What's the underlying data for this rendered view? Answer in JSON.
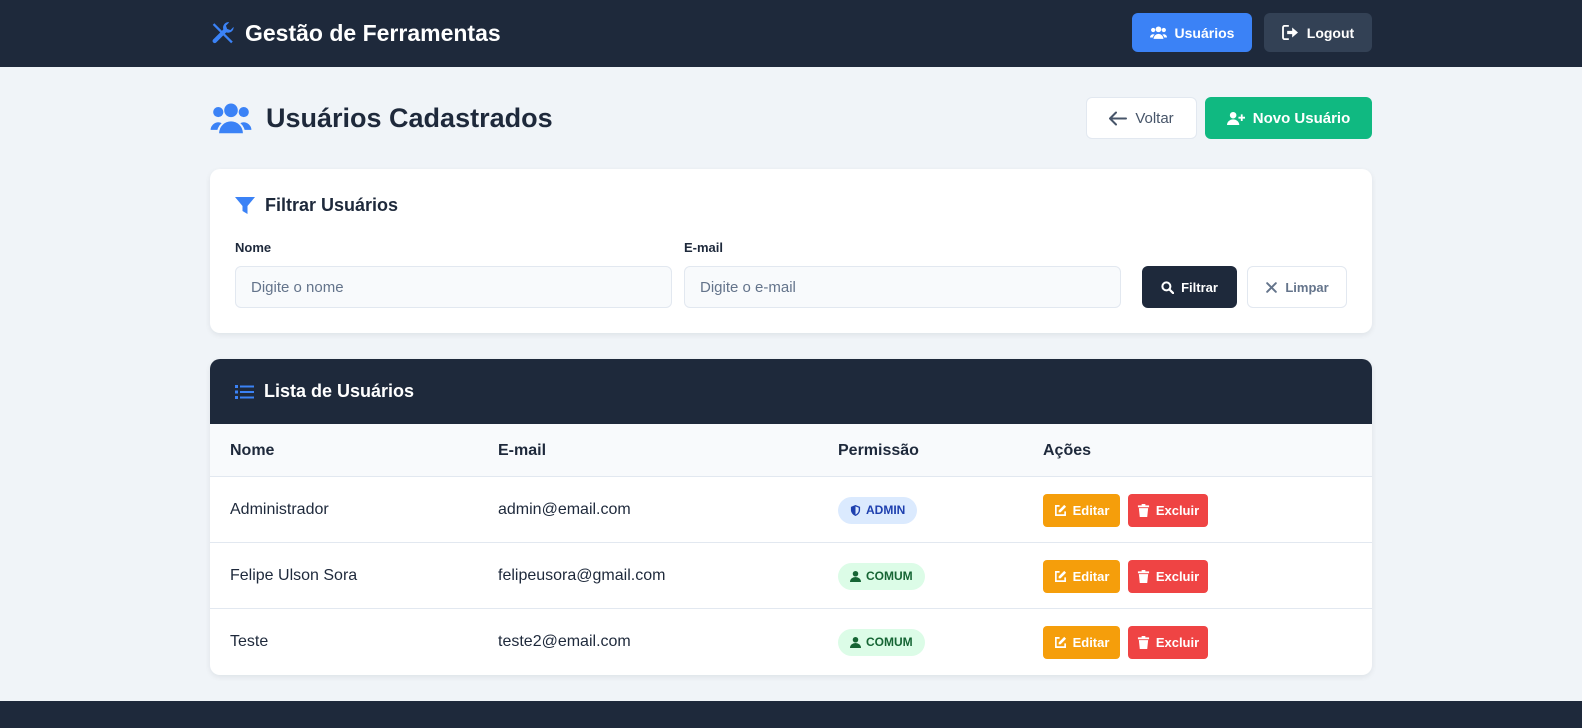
{
  "header": {
    "brand": "Gestão de Ferramentas",
    "brand_icon": "tools-icon",
    "users_label": "Usuários",
    "logout_label": "Logout"
  },
  "page": {
    "title": "Usuários Cadastrados",
    "title_icon": "users-icon",
    "back_label": "Voltar",
    "new_label": "Novo Usuário"
  },
  "filter": {
    "title": "Filtrar Usuários",
    "name_label": "Nome",
    "name_placeholder": "Digite o nome",
    "email_label": "E-mail",
    "email_placeholder": "Digite o e-mail",
    "filter_label": "Filtrar",
    "clear_label": "Limpar"
  },
  "list": {
    "title": "Lista de Usuários",
    "columns": [
      "Nome",
      "E-mail",
      "Permissão",
      "Ações"
    ],
    "rows": [
      {
        "nome": "Administrador",
        "email": "admin@email.com",
        "permissao": "ADMIN"
      },
      {
        "nome": "Felipe Ulson Sora",
        "email": "felipeusora@gmail.com",
        "permissao": "COMUM"
      },
      {
        "nome": "Teste",
        "email": "teste2@email.com",
        "permissao": "COMUM"
      }
    ],
    "edit_label": "Editar",
    "delete_label": "Excluir"
  },
  "colors": {
    "primary": "#3b82f6",
    "dark": "#1e293b",
    "success": "#10b981",
    "warning": "#f59e0b",
    "danger": "#ef4444"
  }
}
